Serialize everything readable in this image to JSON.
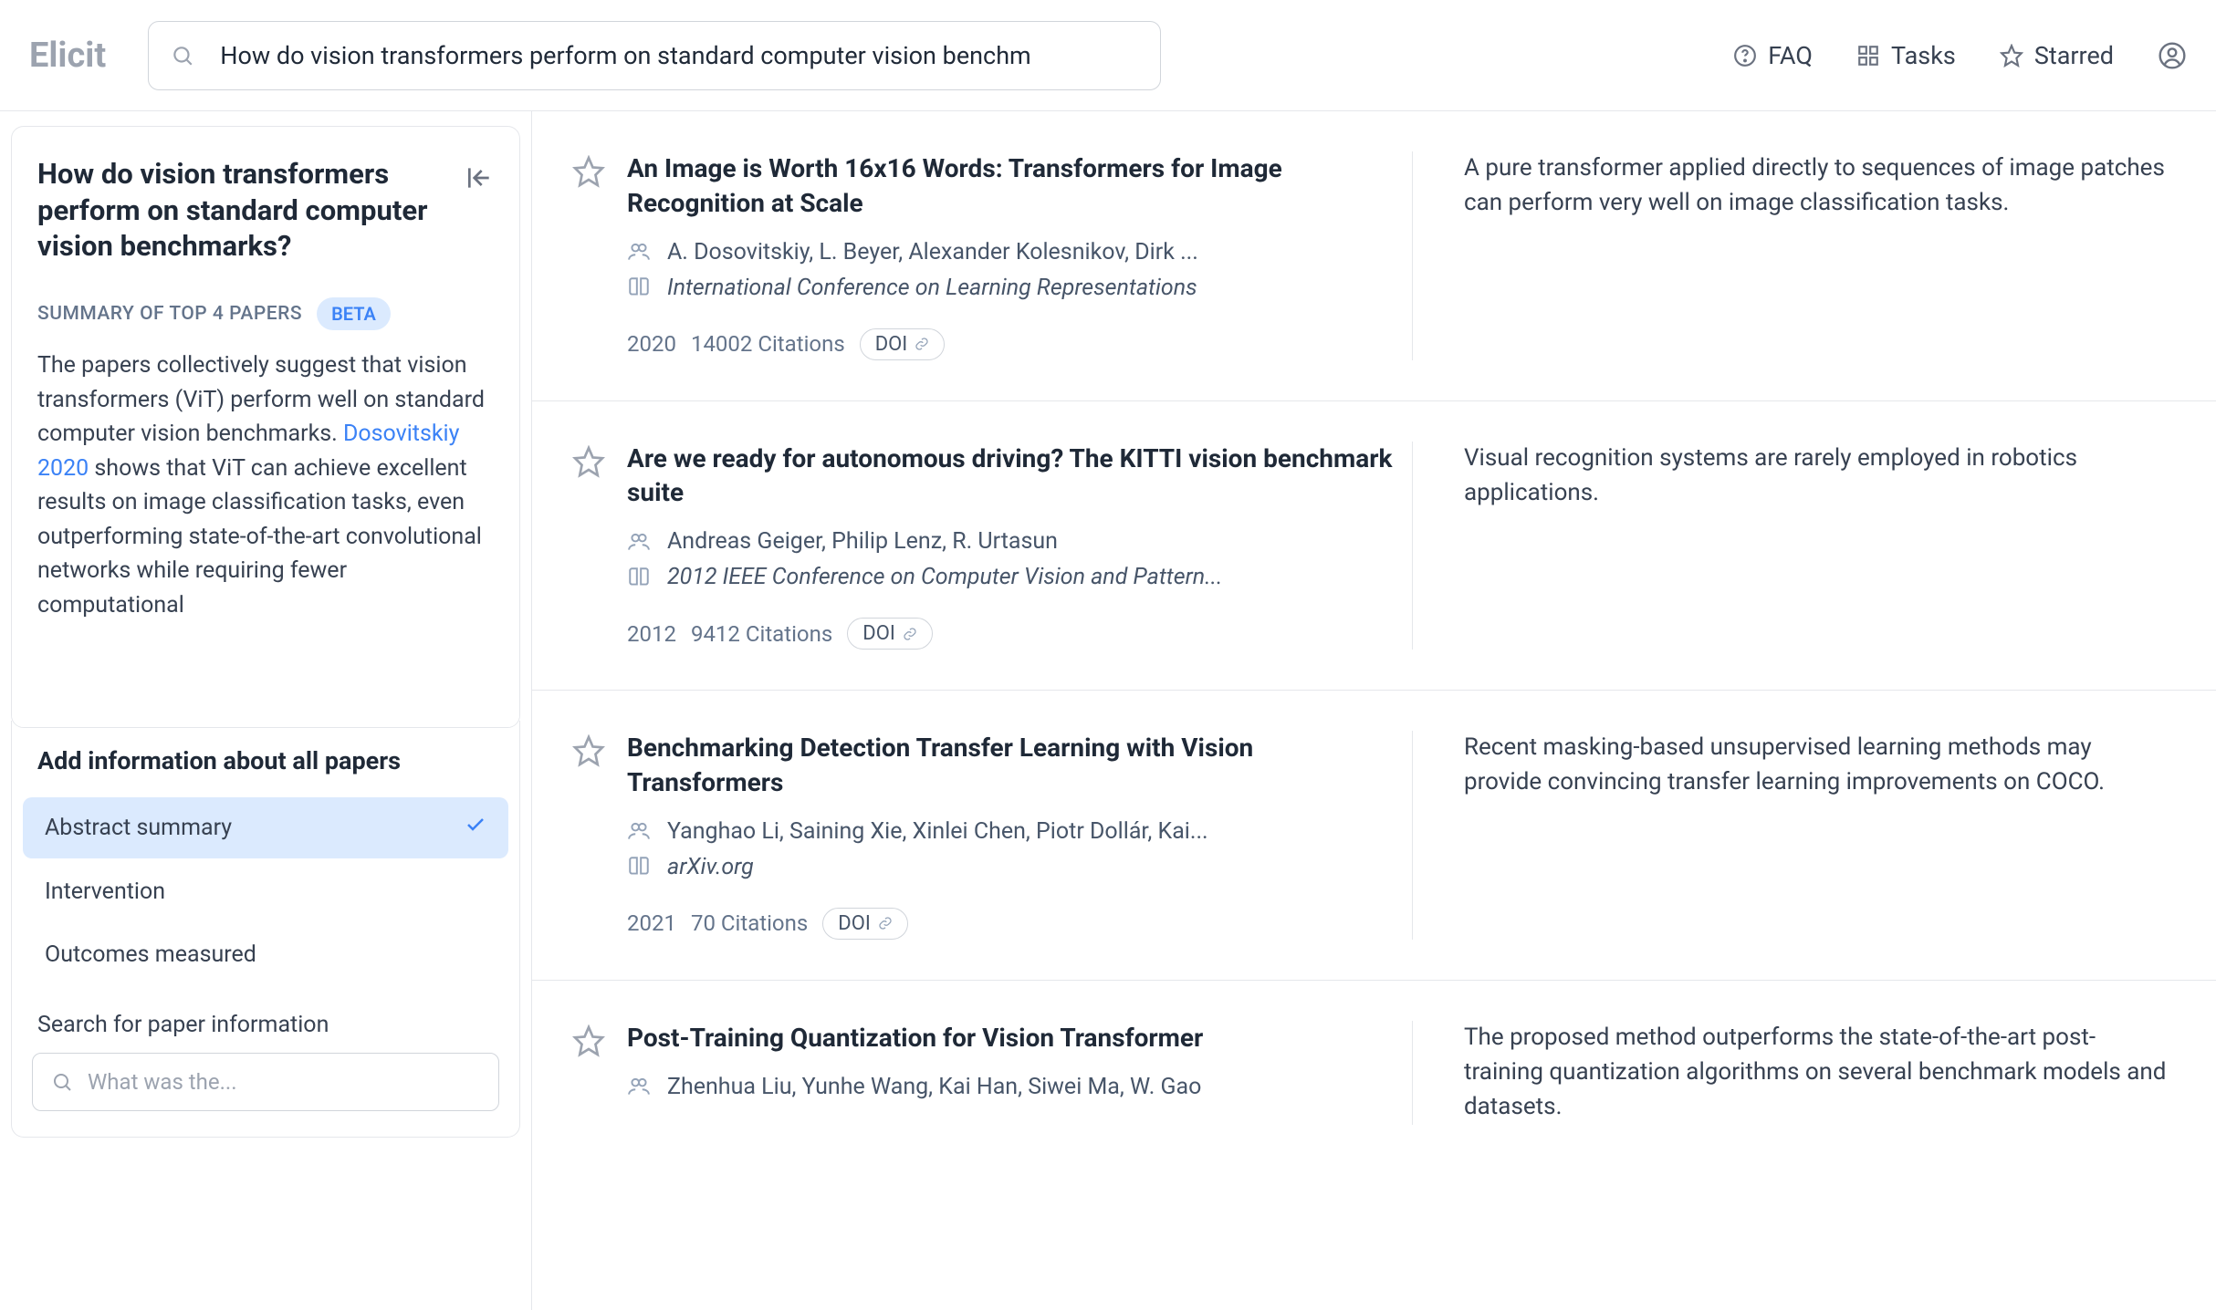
{
  "logo": "Elicit",
  "search": {
    "value": "How do vision transformers perform on standard computer vision benchm"
  },
  "nav": {
    "faq": "FAQ",
    "tasks": "Tasks",
    "starred": "Starred"
  },
  "sidebar": {
    "question": "How do vision transformers perform on standard computer vision benchmarks?",
    "summary_header": "SUMMARY OF TOP 4 PAPERS",
    "beta_label": "BETA",
    "summary_prefix": "The papers collectively suggest that vision transformers (ViT) perform well on standard computer vision benchmarks. ",
    "summary_link": "Dosovitskiy 2020",
    "summary_suffix": " shows that ViT can achieve excellent results on image classification tasks, even outperforming state-of-the-art convolutional networks while requiring fewer computational",
    "columns_title": "Add information about all papers",
    "column_options": [
      {
        "label": "Abstract summary",
        "active": true
      },
      {
        "label": "Intervention",
        "active": false
      },
      {
        "label": "Outcomes measured",
        "active": false
      }
    ],
    "column_search_label": "Search for paper information",
    "column_search_placeholder": "What was the..."
  },
  "doi_label": "DOI",
  "results": [
    {
      "title": "An Image is Worth 16x16 Words: Transformers for Image Recognition at Scale",
      "authors": "A. Dosovitskiy, L. Beyer, Alexander Kolesnikov, Dirk ...",
      "venue": "International Conference on Learning Representations",
      "year": "2020",
      "citations": "14002 Citations",
      "abstract": "A pure transformer applied directly to sequences of image patches can perform very well on image classification tasks."
    },
    {
      "title": "Are we ready for autonomous driving? The KITTI vision benchmark suite",
      "authors": "Andreas Geiger, Philip Lenz, R. Urtasun",
      "venue": "2012 IEEE Conference on Computer Vision and Pattern...",
      "year": "2012",
      "citations": "9412 Citations",
      "abstract": "Visual recognition systems are rarely employed in robotics applications."
    },
    {
      "title": "Benchmarking Detection Transfer Learning with Vision Transformers",
      "authors": "Yanghao Li, Saining Xie, Xinlei Chen, Piotr Dollár, Kai...",
      "venue": "arXiv.org",
      "year": "2021",
      "citations": "70 Citations",
      "abstract": "Recent masking-based unsupervised learning methods may provide convincing transfer learning improvements on COCO."
    },
    {
      "title": "Post-Training Quantization for Vision Transformer",
      "authors": "Zhenhua Liu, Yunhe Wang, Kai Han, Siwei Ma, W. Gao",
      "venue": "",
      "year": "",
      "citations": "",
      "abstract": "The proposed method outperforms the state-of-the-art post-training quantization algorithms on several benchmark models and datasets."
    }
  ]
}
